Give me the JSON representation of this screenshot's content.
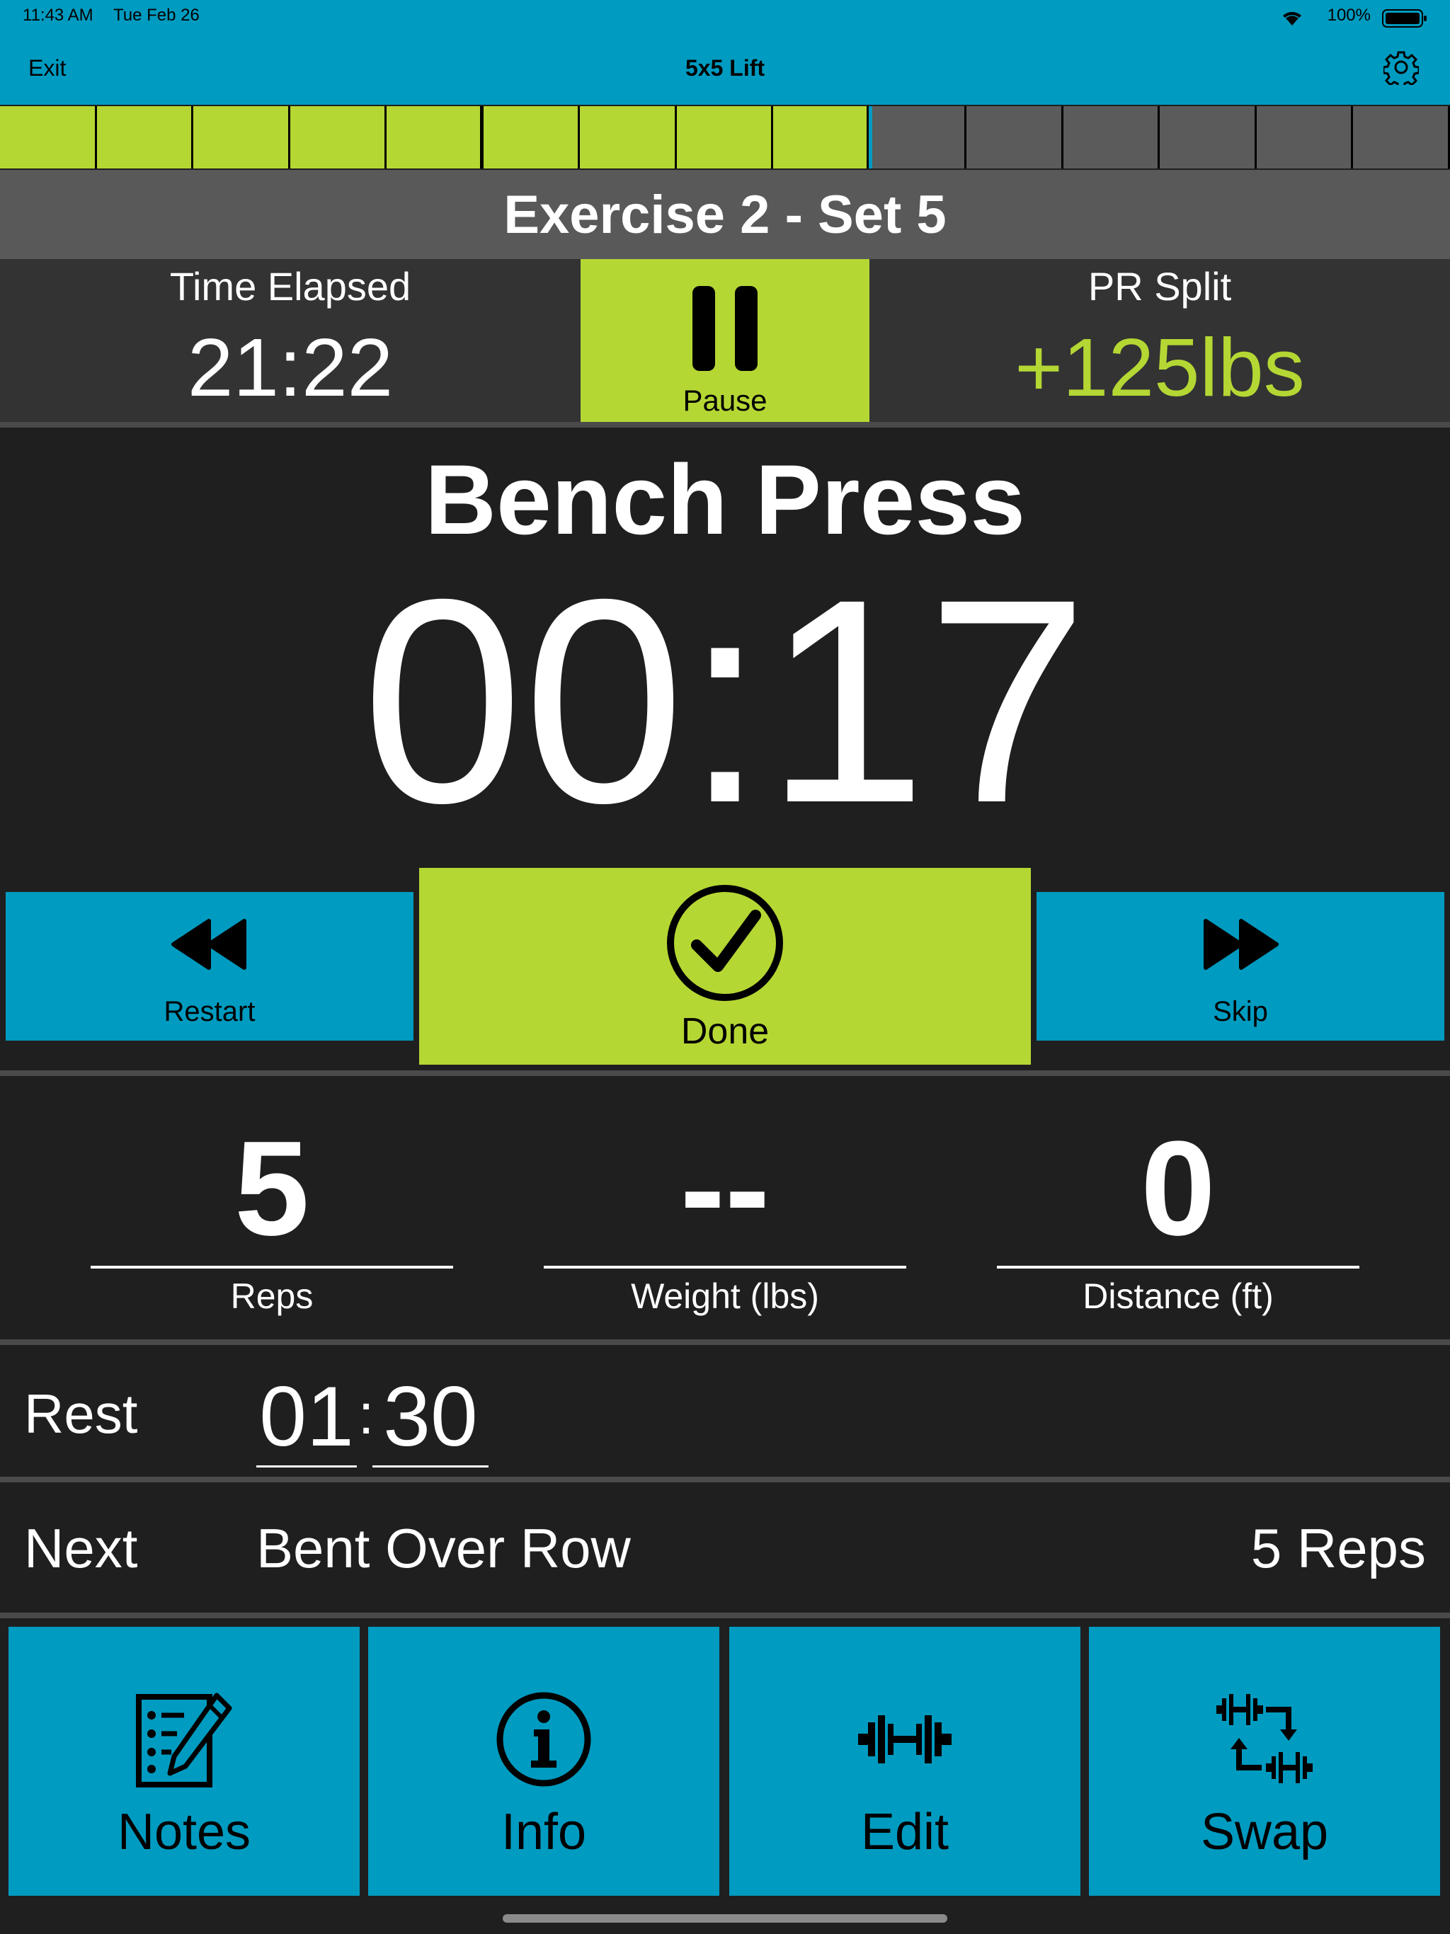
{
  "status": {
    "time": "11:43 AM",
    "date": "Tue Feb 26",
    "battery": "100%"
  },
  "nav": {
    "exit": "Exit",
    "title": "5x5 Lift"
  },
  "progress": {
    "completed_fraction": 0.6,
    "segments": 15,
    "colors": {
      "done": "#b5d734",
      "todo": "#5b5b5b"
    }
  },
  "set_header": "Exercise 2 - Set 5",
  "stats": {
    "elapsed_label": "Time Elapsed",
    "elapsed_value": "21:22",
    "pause_label": "Pause",
    "pr_label": "PR Split",
    "pr_value": "+125lbs"
  },
  "exercise": {
    "name": "Bench Press",
    "timer": "00:17"
  },
  "controls": {
    "restart": "Restart",
    "done": "Done",
    "skip": "Skip"
  },
  "metrics": [
    {
      "value": "5",
      "label": "Reps"
    },
    {
      "value": "--",
      "label": "Weight (lbs)"
    },
    {
      "value": "0",
      "label": "Distance (ft)"
    }
  ],
  "rest": {
    "label": "Rest",
    "minutes": "01",
    "seconds": "30"
  },
  "next": {
    "label": "Next",
    "exercise": "Bent Over Row",
    "reps": "5 Reps"
  },
  "tiles": [
    {
      "label": "Notes",
      "icon": "notes-icon"
    },
    {
      "label": "Info",
      "icon": "info-icon"
    },
    {
      "label": "Edit",
      "icon": "dumbbell-edit-icon"
    },
    {
      "label": "Swap",
      "icon": "swap-icon"
    }
  ],
  "colors": {
    "accent": "#009bc0",
    "lime": "#b5d734",
    "bg": "#1f1f1f"
  }
}
